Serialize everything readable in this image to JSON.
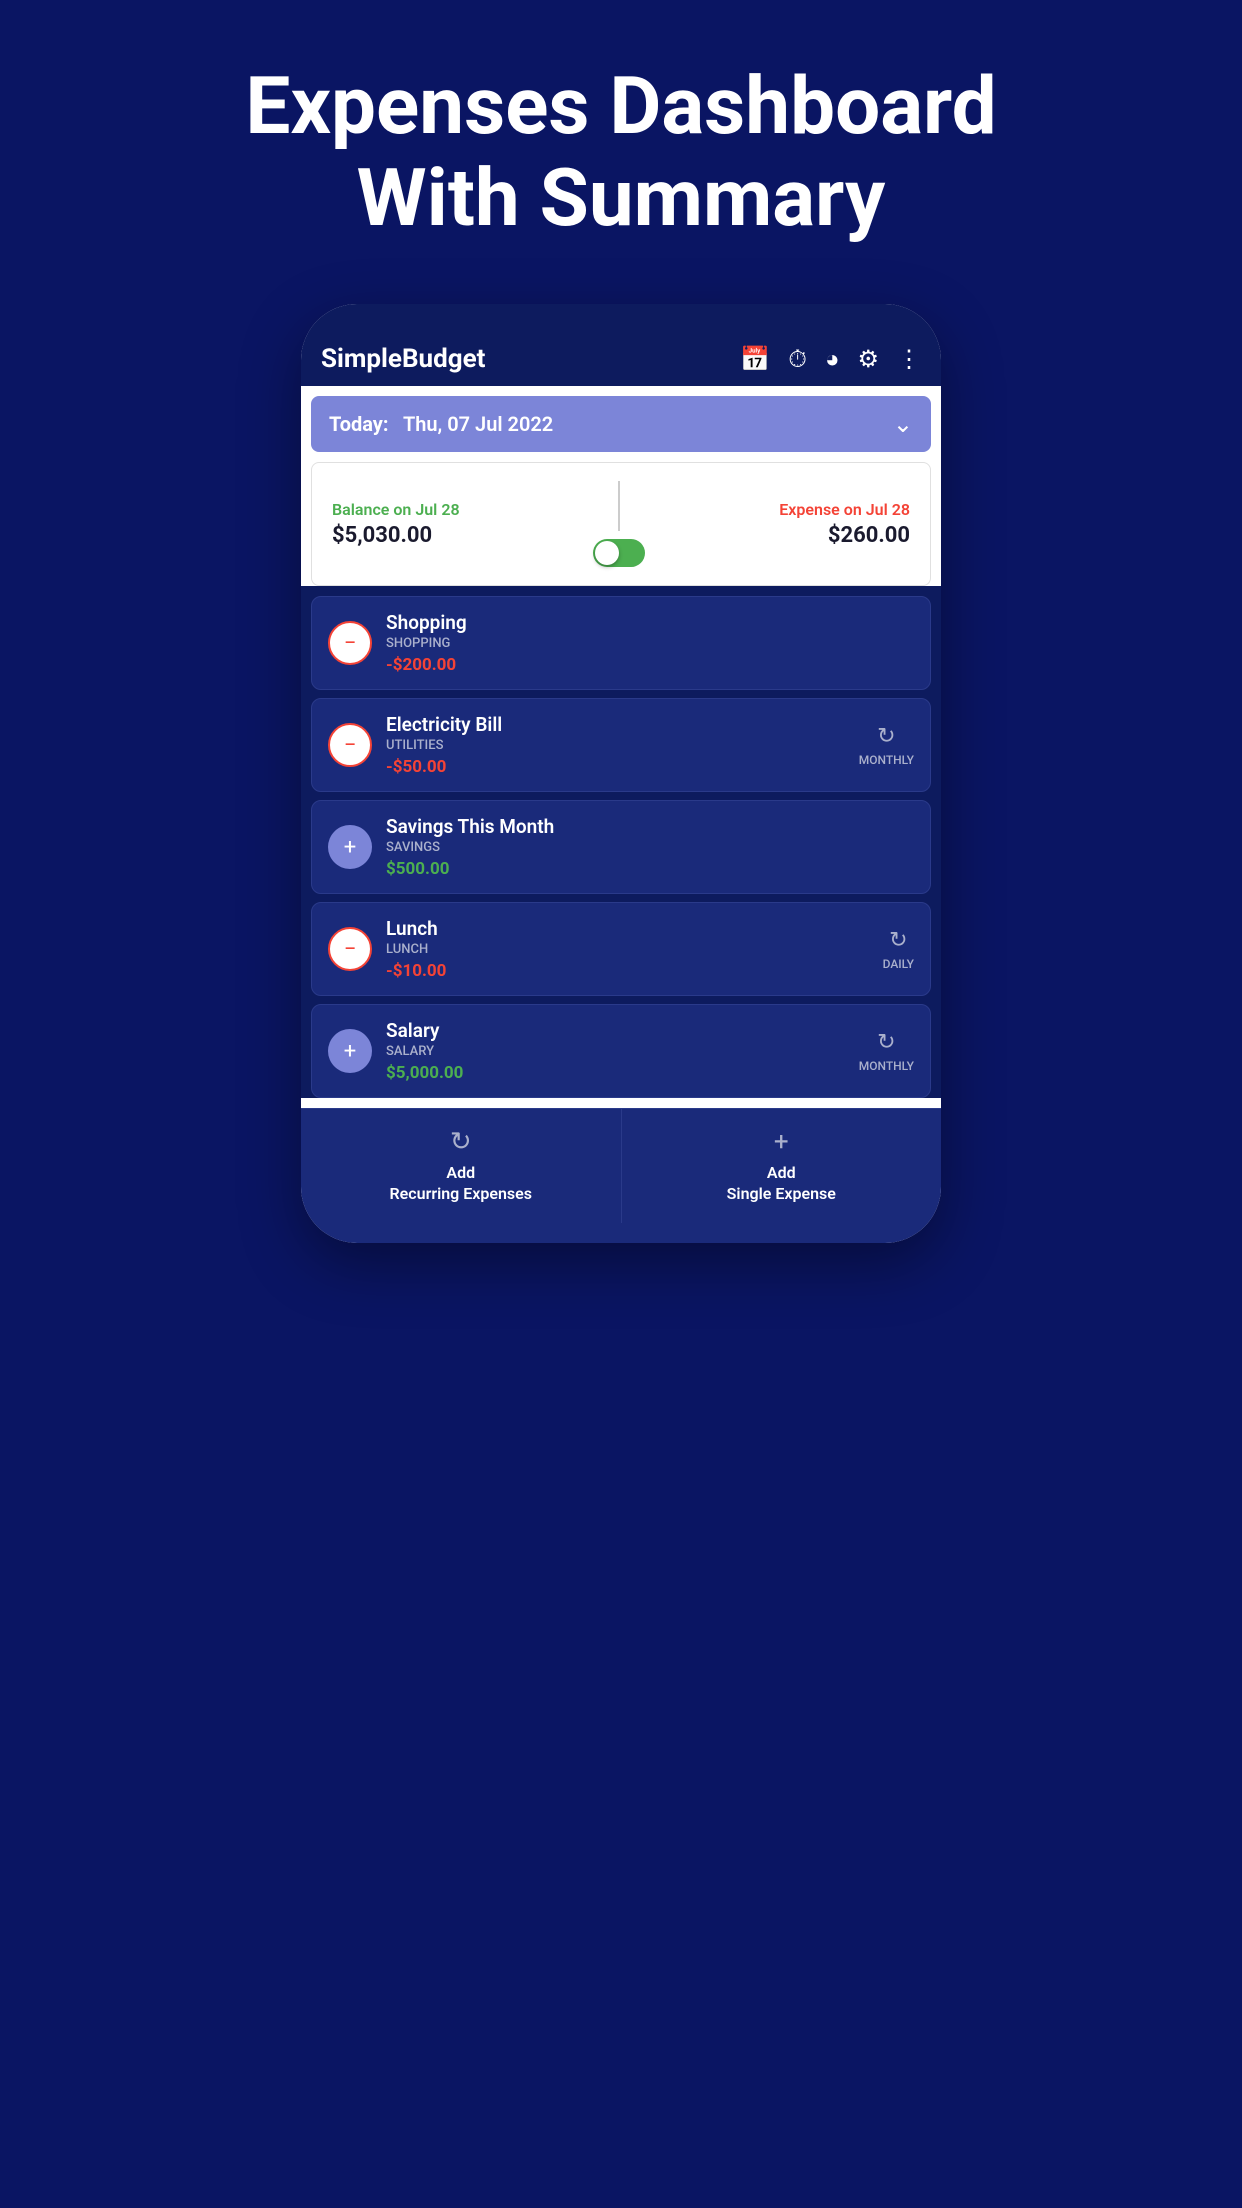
{
  "page": {
    "title_line1": "Expenses Dashboard",
    "title_line2": "With Summary"
  },
  "header": {
    "app_name": "SimpleBudget",
    "icons": [
      "calendar-icon",
      "timer-add-icon",
      "chart-icon",
      "settings-icon",
      "more-icon"
    ]
  },
  "date_bar": {
    "label": "Today:",
    "date": "Thu, 07 Jul 2022"
  },
  "summary": {
    "balance_label": "Balance on Jul 28",
    "balance_value": "$5,030.00",
    "expense_label": "Expense on Jul 28",
    "expense_value": "$260.00"
  },
  "transactions": [
    {
      "name": "Shopping",
      "category": "SHOPPING",
      "amount": "-$200.00",
      "type": "expense",
      "icon_type": "minus",
      "recurring": false,
      "recurring_label": ""
    },
    {
      "name": "Electricity Bill",
      "category": "UTILITIES",
      "amount": "-$50.00",
      "type": "expense",
      "icon_type": "minus",
      "recurring": true,
      "recurring_label": "MONTHLY"
    },
    {
      "name": "Savings This Month",
      "category": "SAVINGS",
      "amount": "$500.00",
      "type": "income",
      "icon_type": "plus",
      "recurring": false,
      "recurring_label": ""
    },
    {
      "name": "Lunch",
      "category": "LUNCH",
      "amount": "-$10.00",
      "type": "expense",
      "icon_type": "minus",
      "recurring": true,
      "recurring_label": "DAILY"
    },
    {
      "name": "Salary",
      "category": "SALARY",
      "amount": "$5,000.00",
      "type": "income",
      "icon_type": "plus",
      "recurring": true,
      "recurring_label": "MONTHLY"
    }
  ],
  "bottom_bar": {
    "btn1_label": "Add\nRecurring Expenses",
    "btn2_label": "Add\nSingle Expense"
  },
  "colors": {
    "background": "#0a1563",
    "header_bg": "#0d1b5e",
    "card_bg": "#1a2a7a",
    "date_bar": "#7c85d8",
    "positive": "#4caf50",
    "negative": "#f44336",
    "recurring_icon": "#aab0cc"
  }
}
